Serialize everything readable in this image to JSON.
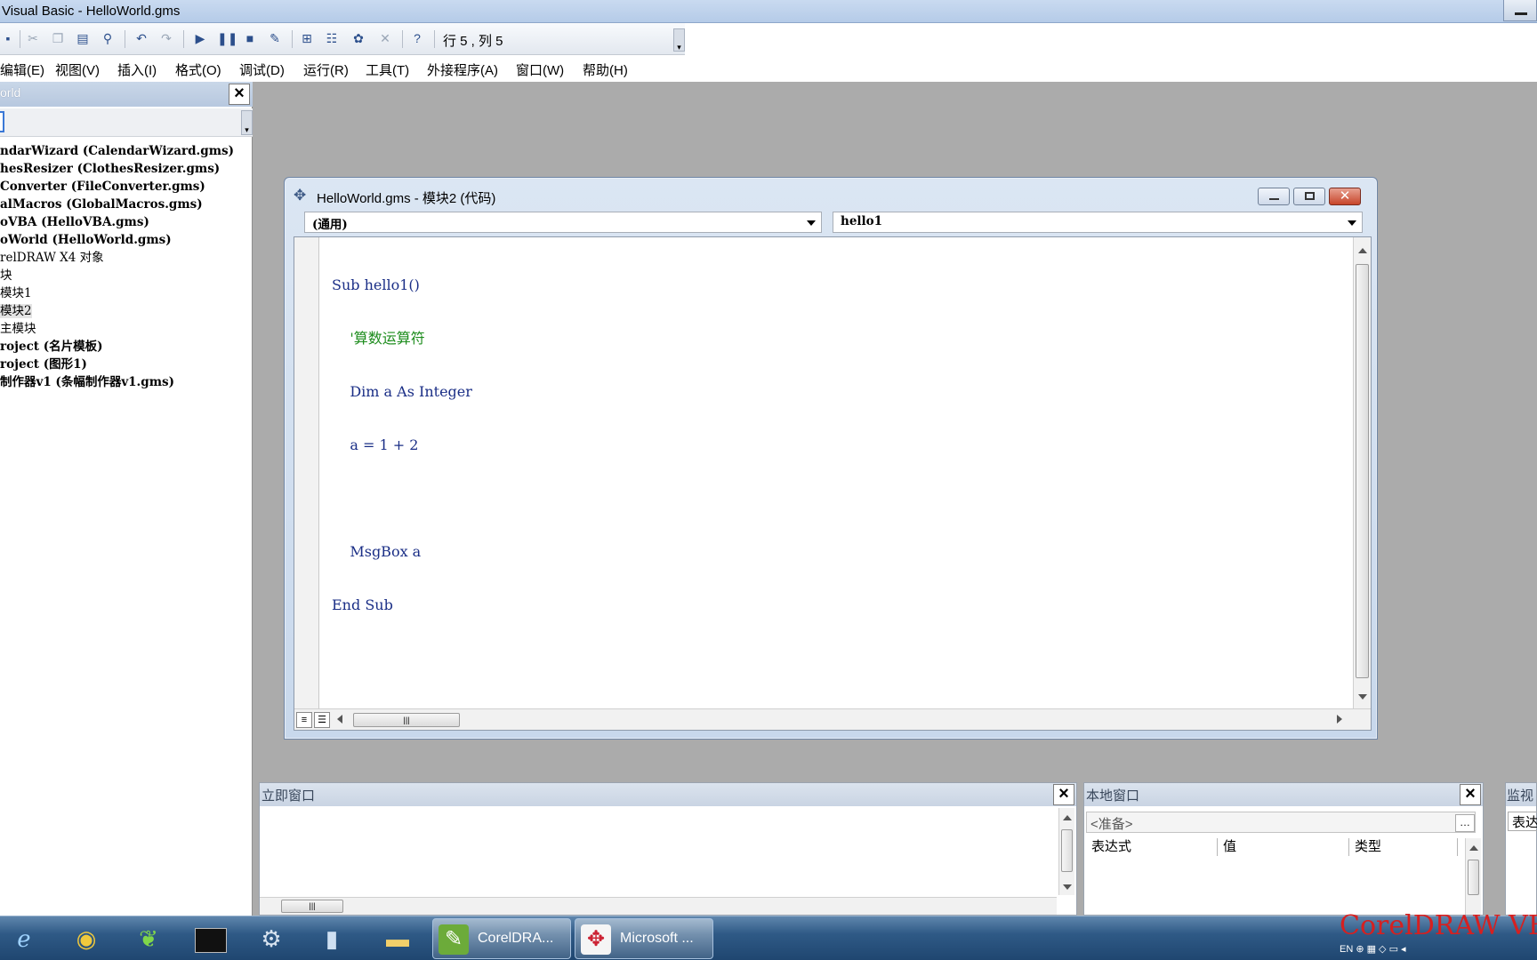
{
  "window": {
    "title": "Visual Basic - HelloWorld.gms"
  },
  "toolbar": {
    "position_label": "行 5 , 列 5"
  },
  "menu": [
    {
      "label": "编辑(E)"
    },
    {
      "label": "视图(V)"
    },
    {
      "label": "插入(I)"
    },
    {
      "label": "格式(O)"
    },
    {
      "label": "调试(D)"
    },
    {
      "label": "运行(R)"
    },
    {
      "label": "工具(T)"
    },
    {
      "label": "外接程序(A)"
    },
    {
      "label": "窗口(W)"
    },
    {
      "label": "帮助(H)"
    }
  ],
  "project": {
    "title": "orld",
    "tree": [
      {
        "label": "ndarWizard (CalendarWizard.gms)",
        "bold": true
      },
      {
        "label": "hesResizer (ClothesResizer.gms)",
        "bold": true
      },
      {
        "label": "Converter (FileConverter.gms)",
        "bold": true
      },
      {
        "label": "alMacros (GlobalMacros.gms)",
        "bold": true
      },
      {
        "label": "oVBA (HelloVBA.gms)",
        "bold": true
      },
      {
        "label": "oWorld (HelloWorld.gms)",
        "bold": true
      },
      {
        "label": "relDRAW X4 对象",
        "bold": false
      },
      {
        "label": "块",
        "bold": false
      },
      {
        "label": " 模块1",
        "bold": false
      },
      {
        "label": " 模块2",
        "bold": false
      },
      {
        "label": " 主模块",
        "bold": false
      },
      {
        "label": "roject (名片模板)",
        "bold": true
      },
      {
        "label": "roject (图形1)",
        "bold": true
      },
      {
        "label": "制作器v1 (条幅制作器v1.gms)",
        "bold": true
      }
    ]
  },
  "code_window": {
    "title": "HelloWorld.gms - 模块2 (代码)",
    "object_combo": "(通用)",
    "proc_combo": "hello1",
    "lines": [
      {
        "text": "Sub hello1()",
        "type": "code"
      },
      {
        "text": "    '算数运算符",
        "type": "comment"
      },
      {
        "text": "    Dim a As Integer",
        "type": "code"
      },
      {
        "text": "    a = 1 + 2",
        "type": "code"
      },
      {
        "text": "",
        "type": "code"
      },
      {
        "text": "    MsgBox a",
        "type": "code"
      },
      {
        "text": "End Sub",
        "type": "code"
      }
    ]
  },
  "immediate": {
    "title": "立即窗口"
  },
  "locals": {
    "title": "本地窗口",
    "status": "<准备>",
    "columns": [
      "表达式",
      "值",
      "类型"
    ]
  },
  "watch": {
    "title": "监视",
    "column": "表达"
  },
  "taskbar": {
    "tasks": [
      {
        "label": "CorelDRA..."
      },
      {
        "label": "Microsoft ..."
      }
    ],
    "watermark": "CorelDRAW VBA"
  },
  "colors": {
    "comment": "#1c8c1c",
    "keyword": "#1a2e86",
    "watermark": "#d62020"
  }
}
